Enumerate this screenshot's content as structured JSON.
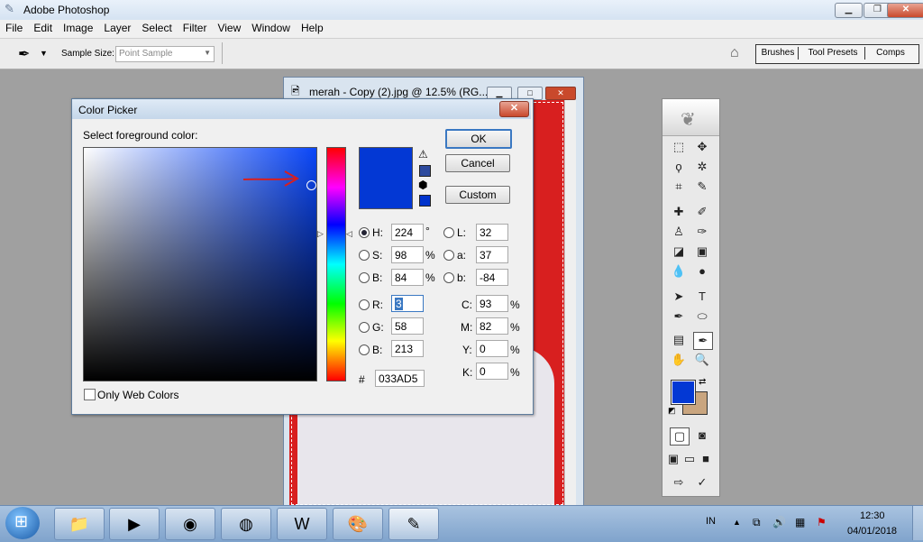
{
  "app": {
    "title": "Adobe Photoshop"
  },
  "menu": [
    "File",
    "Edit",
    "Image",
    "Layer",
    "Select",
    "Filter",
    "View",
    "Window",
    "Help"
  ],
  "options": {
    "sample_size_label": "Sample Size:",
    "sample_size_value": "Point Sample"
  },
  "palette_tabs": [
    "Brushes",
    "Tool Presets",
    "Comps"
  ],
  "document": {
    "title": "merah - Copy (2).jpg @ 12.5% (RG..."
  },
  "dialog": {
    "title": "Color Picker",
    "prompt": "Select foreground color:",
    "ok": "OK",
    "cancel": "Cancel",
    "custom": "Custom",
    "hsb": {
      "H": "224",
      "S": "98",
      "B": "84"
    },
    "hsb_labels": {
      "H": "H:",
      "S": "S:",
      "B": "B:"
    },
    "hsb_units": {
      "H": "°",
      "S": "%",
      "B": "%"
    },
    "lab": {
      "L": "32",
      "a": "37",
      "b": "-84"
    },
    "lab_labels": {
      "L": "L:",
      "a": "a:",
      "b": "b:"
    },
    "rgb": {
      "R": "3",
      "G": "58",
      "B": "213"
    },
    "rgb_labels": {
      "R": "R:",
      "G": "G:",
      "B": "B:"
    },
    "cmyk": {
      "C": "93",
      "M": "82",
      "Y": "0",
      "K": "0"
    },
    "cmyk_labels": {
      "C": "C:",
      "M": "M:",
      "Y": "Y:",
      "K": "K:"
    },
    "pct": "%",
    "hash": "#",
    "hex": "033AD5",
    "web_colors": "Only Web Colors",
    "new_color": "#0338d4"
  },
  "colors": {
    "foreground": "#0338d4",
    "background": "#c9a57f",
    "red": "#d81f1f"
  },
  "taskbar": {
    "lang": "IN",
    "time": "12:30",
    "date": "04/01/2018"
  }
}
